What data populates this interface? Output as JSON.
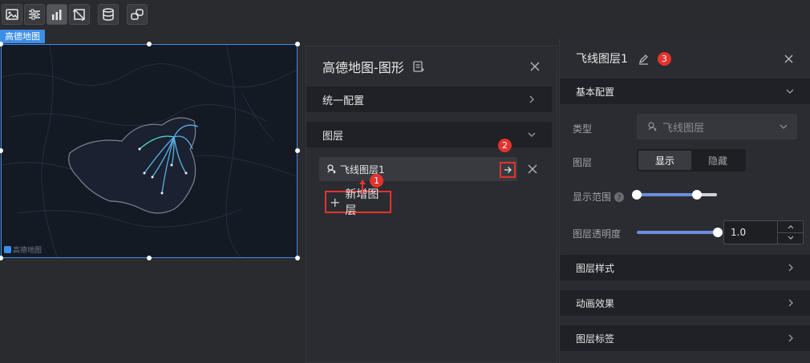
{
  "toolbar": {
    "buttons": [
      "image-icon",
      "sliders-icon",
      "bar-chart-icon",
      "crop-icon",
      "database-icon",
      "link-icon"
    ],
    "active_index": 2
  },
  "widget": {
    "tag_label": "高德地图",
    "map_logo_text": "高德地图"
  },
  "middle_panel": {
    "title": "高德地图-图形",
    "sections": [
      {
        "label": "统一配置",
        "expanded": false
      },
      {
        "label": "图层",
        "expanded": true
      }
    ],
    "layer": {
      "label": "飞线图层1",
      "icon": "flyline-icon"
    },
    "add_layer_label": "新增图层",
    "badge1": "1",
    "badge2": "2"
  },
  "right_panel": {
    "title": "飞线图层1",
    "badge3": "3",
    "basic_config_label": "基本配置",
    "type_label": "类型",
    "type_value": "飞线图层",
    "layer_label": "图层",
    "show_label": "显示",
    "hide_label": "隐藏",
    "visibility": "显示",
    "display_range_label": "显示范围",
    "display_range": [
      0,
      0.75
    ],
    "opacity_label": "图层透明度",
    "opacity_value": "1.0",
    "sections": [
      {
        "label": "图层样式"
      },
      {
        "label": "动画效果"
      },
      {
        "label": "图层标签"
      }
    ]
  },
  "colors": {
    "accent": "#3d8ee9",
    "highlight": "#e5322d",
    "panel": "#2b2c31",
    "section": "#202126"
  }
}
